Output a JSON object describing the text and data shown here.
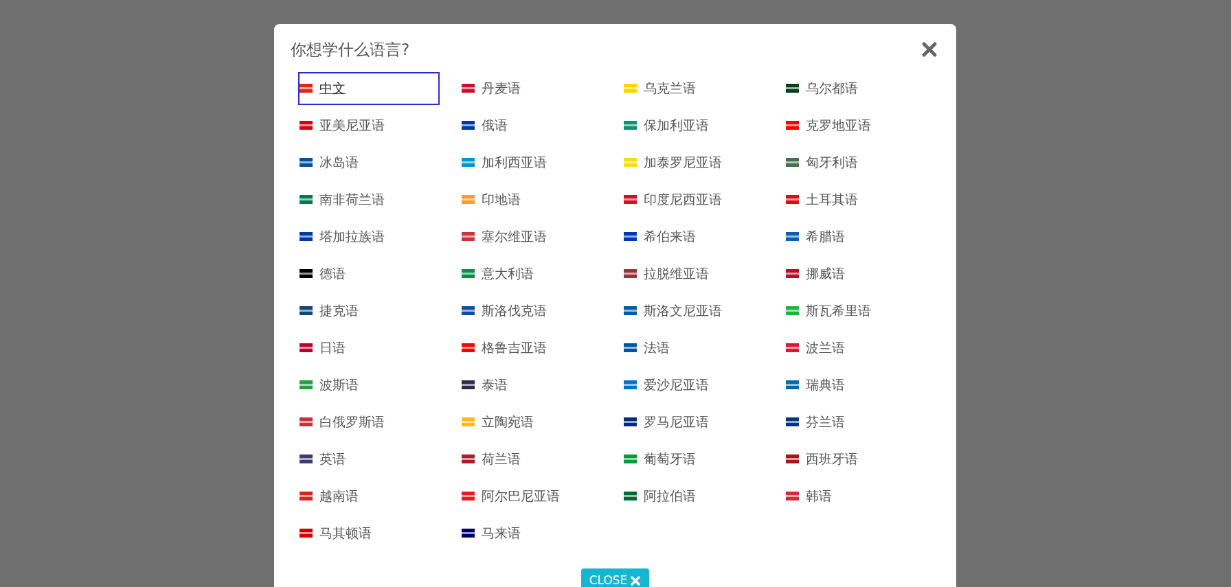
{
  "dialog": {
    "title": "你想学什么语言?",
    "languages": [
      {
        "label": "中文",
        "color": "#de2910",
        "selected": true
      },
      {
        "label": "丹麦语",
        "color": "#c8102e",
        "selected": false
      },
      {
        "label": "乌克兰语",
        "color": "#ffd500",
        "selected": false
      },
      {
        "label": "乌尔都语",
        "color": "#01411c",
        "selected": false
      },
      {
        "label": "亚美尼亚语",
        "color": "#d90012",
        "selected": false
      },
      {
        "label": "俄语",
        "color": "#0039a6",
        "selected": false
      },
      {
        "label": "保加利亚语",
        "color": "#00966e",
        "selected": false
      },
      {
        "label": "克罗地亚语",
        "color": "#ff0000",
        "selected": false
      },
      {
        "label": "冰岛语",
        "color": "#02529c",
        "selected": false
      },
      {
        "label": "加利西亚语",
        "color": "#0099cc",
        "selected": false
      },
      {
        "label": "加泰罗尼亚语",
        "color": "#fcdd09",
        "selected": false
      },
      {
        "label": "匈牙利语",
        "color": "#477050",
        "selected": false
      },
      {
        "label": "南非荷兰语",
        "color": "#007a4d",
        "selected": false
      },
      {
        "label": "印地语",
        "color": "#ff9933",
        "selected": false
      },
      {
        "label": "印度尼西亚语",
        "color": "#ce1126",
        "selected": false
      },
      {
        "label": "土耳其语",
        "color": "#e30a17",
        "selected": false
      },
      {
        "label": "塔加拉族语",
        "color": "#0038a8",
        "selected": false
      },
      {
        "label": "塞尔维亚语",
        "color": "#c6363c",
        "selected": false
      },
      {
        "label": "希伯来语",
        "color": "#0038b8",
        "selected": false
      },
      {
        "label": "希腊语",
        "color": "#0d5eaf",
        "selected": false
      },
      {
        "label": "德语",
        "color": "#000000",
        "selected": false
      },
      {
        "label": "意大利语",
        "color": "#009246",
        "selected": false
      },
      {
        "label": "拉脱维亚语",
        "color": "#9e3039",
        "selected": false
      },
      {
        "label": "挪威语",
        "color": "#ba0c2f",
        "selected": false
      },
      {
        "label": "捷克语",
        "color": "#11457e",
        "selected": false
      },
      {
        "label": "斯洛伐克语",
        "color": "#0b4ea2",
        "selected": false
      },
      {
        "label": "斯洛文尼亚语",
        "color": "#005da4",
        "selected": false
      },
      {
        "label": "斯瓦希里语",
        "color": "#1eb53a",
        "selected": false
      },
      {
        "label": "日语",
        "color": "#bc002d",
        "selected": false
      },
      {
        "label": "格鲁吉亚语",
        "color": "#ff0000",
        "selected": false
      },
      {
        "label": "法语",
        "color": "#0055a4",
        "selected": false
      },
      {
        "label": "波兰语",
        "color": "#dc143c",
        "selected": false
      },
      {
        "label": "波斯语",
        "color": "#239f40",
        "selected": false
      },
      {
        "label": "泰语",
        "color": "#2d2a4a",
        "selected": false
      },
      {
        "label": "爱沙尼亚语",
        "color": "#0072ce",
        "selected": false
      },
      {
        "label": "瑞典语",
        "color": "#006aa7",
        "selected": false
      },
      {
        "label": "白俄罗斯语",
        "color": "#c8313e",
        "selected": false
      },
      {
        "label": "立陶宛语",
        "color": "#fdb913",
        "selected": false
      },
      {
        "label": "罗马尼亚语",
        "color": "#002b7f",
        "selected": false
      },
      {
        "label": "芬兰语",
        "color": "#003580",
        "selected": false
      },
      {
        "label": "英语",
        "color": "#3c3b6e",
        "selected": false
      },
      {
        "label": "荷兰语",
        "color": "#ae1c28",
        "selected": false
      },
      {
        "label": "葡萄牙语",
        "color": "#009c3b",
        "selected": false
      },
      {
        "label": "西班牙语",
        "color": "#aa151b",
        "selected": false
      },
      {
        "label": "越南语",
        "color": "#da251d",
        "selected": false
      },
      {
        "label": "阿尔巴尼亚语",
        "color": "#e41e20",
        "selected": false
      },
      {
        "label": "阿拉伯语",
        "color": "#006c35",
        "selected": false
      },
      {
        "label": "韩语",
        "color": "#cd2e3a",
        "selected": false
      },
      {
        "label": "马其顿语",
        "color": "#d20000",
        "selected": false
      },
      {
        "label": "马来语",
        "color": "#010066",
        "selected": false
      }
    ],
    "close_button": "CLOSE"
  }
}
